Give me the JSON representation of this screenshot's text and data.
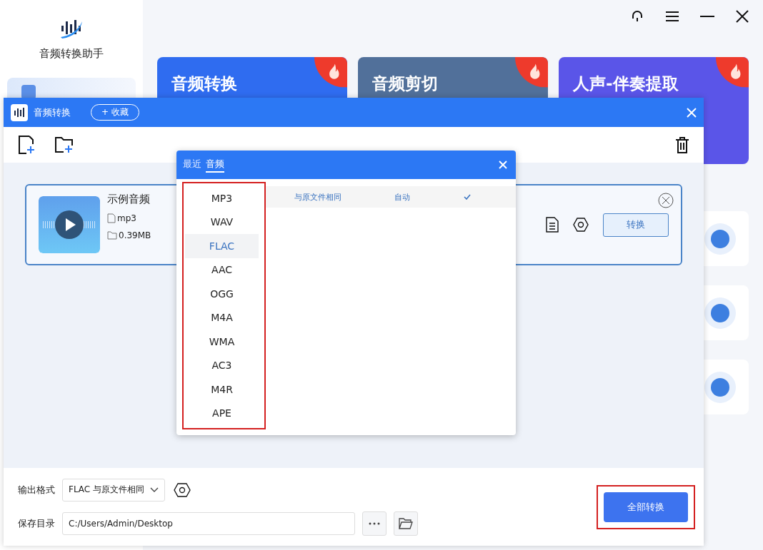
{
  "app": {
    "title": "音频转换助手"
  },
  "feature_cards": [
    {
      "title": "音频转换",
      "color": "#2f6cf0"
    },
    {
      "title": "音频剪切",
      "color": "#51709a"
    },
    {
      "title": "人声-伴奏提取",
      "color": "#5a55e8"
    }
  ],
  "dialog": {
    "title": "音频转换",
    "favorite_button": "+ 收藏",
    "file": {
      "name": "示例音频",
      "format": "mp3",
      "size": "0.39MB",
      "convert_button": "转换"
    },
    "footer": {
      "format_label": "输出格式",
      "format_value": "FLAC 与原文件相同",
      "dir_label": "保存目录",
      "dir_value": "C:/Users/Admin/Desktop",
      "convert_all_button": "全部转换"
    }
  },
  "popup": {
    "tabs": [
      {
        "label": "最近",
        "selected": false
      },
      {
        "label": "音频",
        "selected": true
      }
    ],
    "formats": [
      {
        "label": "MP3",
        "selected": false
      },
      {
        "label": "WAV",
        "selected": false
      },
      {
        "label": "FLAC",
        "selected": true
      },
      {
        "label": "AAC",
        "selected": false
      },
      {
        "label": "OGG",
        "selected": false
      },
      {
        "label": "M4A",
        "selected": false
      },
      {
        "label": "WMA",
        "selected": false
      },
      {
        "label": "AC3",
        "selected": false
      },
      {
        "label": "M4R",
        "selected": false
      },
      {
        "label": "APE",
        "selected": false
      }
    ],
    "options": [
      {
        "quality": "与原文件相同",
        "rate": "自动",
        "checked": true
      }
    ]
  }
}
